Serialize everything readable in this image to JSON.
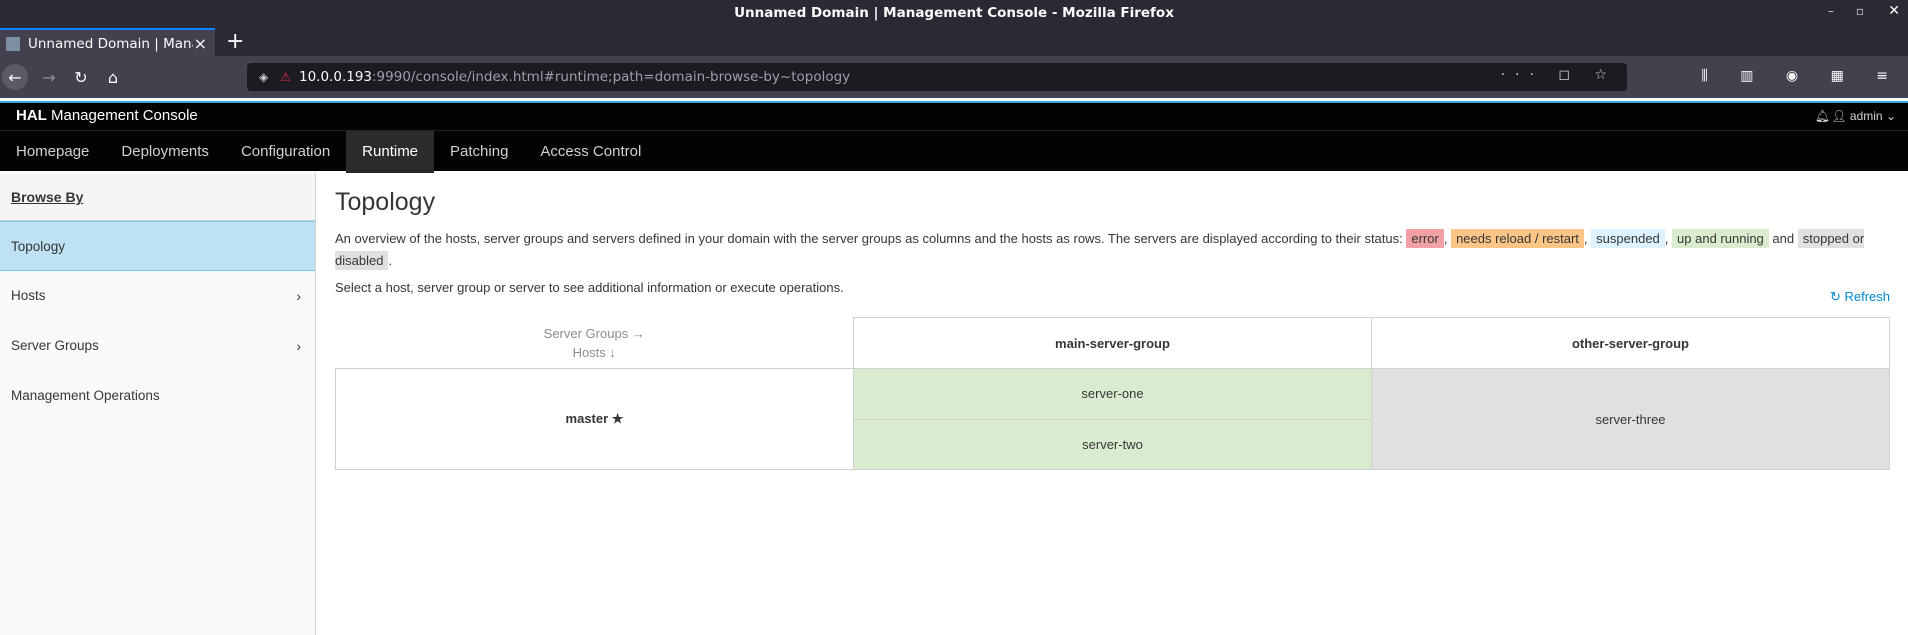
{
  "browser": {
    "window_title": "Unnamed Domain | Management Console - Mozilla Firefox",
    "tab_title": "Unnamed Domain | Management Console",
    "url_host": "10.0.0.193",
    "url_rest": ":9990/console/index.html#runtime;path=domain-browse-by~topology"
  },
  "hal": {
    "brand_bold": "HAL",
    "brand_rest": " Management Console",
    "user": "admin",
    "nav": [
      "Homepage",
      "Deployments",
      "Configuration",
      "Runtime",
      "Patching",
      "Access Control"
    ],
    "active_nav": "Runtime"
  },
  "sidebar": {
    "title": "Browse By",
    "items": [
      {
        "label": "Topology",
        "active": true
      },
      {
        "label": "Hosts",
        "has_children": true
      },
      {
        "label": "Server Groups",
        "has_children": true
      },
      {
        "label": "Management Operations"
      }
    ]
  },
  "main": {
    "title": "Topology",
    "desc_prefix": "An overview of the hosts, server groups and servers defined in your domain with the server groups as columns and the hosts as rows. The servers are displayed according to their status: ",
    "status_labels": {
      "error": "error",
      "reload": "needs reload / restart",
      "suspended": "suspended",
      "running": "up and running",
      "stopped": "stopped or disabled"
    },
    "sep_comma": ",",
    "sep_and": "and",
    "period": ".",
    "desc2": "Select a host, server group or server to see additional information or execute operations.",
    "refresh": "Refresh",
    "corner_line1": "Server Groups →",
    "corner_line2": "Hosts ↓",
    "groups": [
      "main-server-group",
      "other-server-group"
    ],
    "host": "master",
    "servers": {
      "main": [
        "server-one",
        "server-two"
      ],
      "other": [
        "server-three"
      ]
    }
  },
  "colors": {
    "accent": "#39a5dc",
    "running": "#d9ecd0",
    "stopped": "#e0e0e0",
    "error": "#f1a0a3",
    "reload": "#fbc586",
    "suspended": "#def3ff",
    "link": "#0088ce"
  }
}
